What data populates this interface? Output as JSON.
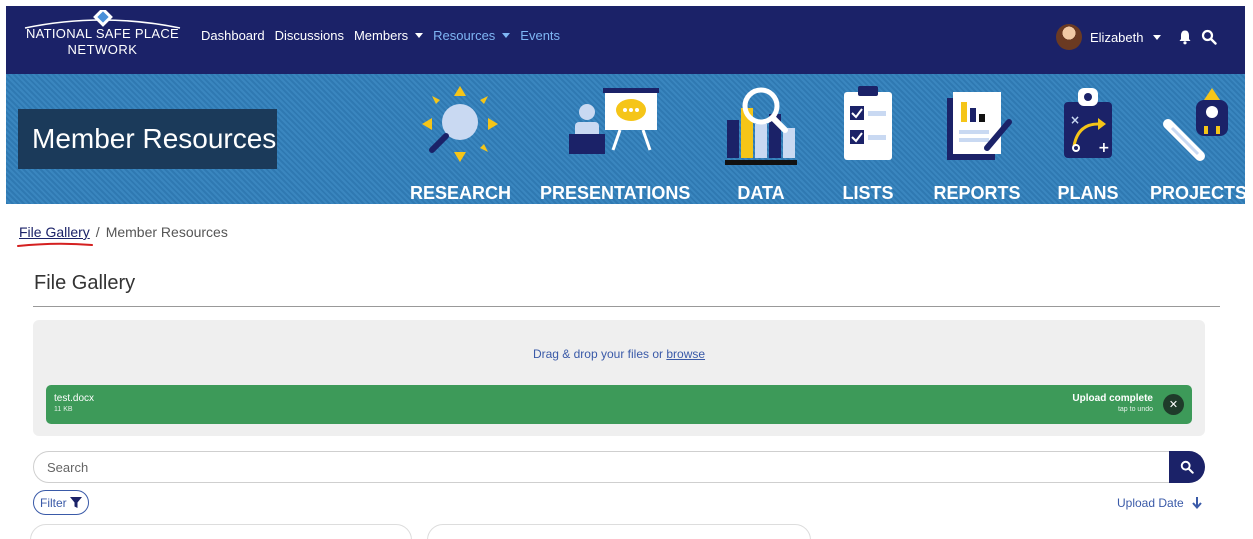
{
  "brand": {
    "line1": "NATIONAL SAFE PLACE",
    "line2": "NETWORK"
  },
  "nav": [
    {
      "label": "Dashboard",
      "dropdown": false,
      "state": "normal"
    },
    {
      "label": "Discussions",
      "dropdown": false,
      "state": "normal"
    },
    {
      "label": "Members",
      "dropdown": true,
      "state": "normal"
    },
    {
      "label": "Resources",
      "dropdown": true,
      "state": "active"
    },
    {
      "label": "Events",
      "dropdown": false,
      "state": "muted"
    }
  ],
  "user": {
    "name": "Elizabeth"
  },
  "banner": {
    "title": "Member Resources",
    "tiles": [
      "RESEARCH",
      "PRESENTATIONS",
      "DATA",
      "LISTS",
      "REPORTS",
      "PLANS",
      "PROJECTS"
    ]
  },
  "breadcrumb": {
    "link": "File Gallery",
    "separator": "/",
    "current": "Member Resources"
  },
  "page_title": "File Gallery",
  "dropzone": {
    "text": "Drag & drop your files or ",
    "browse": "browse",
    "file": {
      "name": "test.docx",
      "size": "11 KB",
      "status": "Upload complete",
      "undo": "tap to undo"
    }
  },
  "search": {
    "placeholder": "Search"
  },
  "filter": {
    "label": "Filter"
  },
  "sort": {
    "label": "Upload Date"
  },
  "colors": {
    "navbar": "#1b2268",
    "banner": "#3580b9",
    "upload_green": "#3d9a59",
    "link": "#3a5aa8"
  }
}
